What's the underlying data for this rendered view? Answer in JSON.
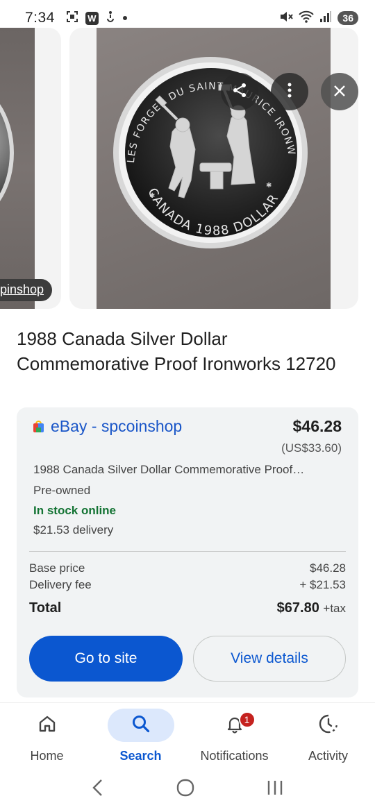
{
  "status_bar": {
    "time": "7:34",
    "left_icons": [
      "screenshot-icon",
      "w-app-icon",
      "accessibility-icon",
      "dot-icon"
    ],
    "right_icons": [
      "mute-icon",
      "wifi-icon",
      "signal-icon"
    ],
    "battery": "36",
    "w_label": "W"
  },
  "carousel": {
    "source_chip_left": "pinshop",
    "coin_inscription_top": "LES FORGES DU SAINT-MAURICE IRONWORKS",
    "coin_inscription_bottom": "CANADA 1988 DOLLAR",
    "actions": [
      "share-icon",
      "more-vert-icon",
      "close-icon"
    ]
  },
  "product": {
    "title": "1988 Canada Silver Dollar Commemorative Proof Ironworks 12720"
  },
  "offer": {
    "merchant": "eBay - spcoinshop",
    "price": "$46.28",
    "price_usd": "(US$33.60)",
    "description": "1988 Canada Silver Dollar Commemorative Proof…",
    "condition": "Pre-owned",
    "stock_status": "In stock online",
    "delivery": "$21.53 delivery",
    "breakdown": {
      "base_label": "Base price",
      "base_value": "$46.28",
      "fee_label": "Delivery fee",
      "fee_value": "+ $21.53",
      "total_label": "Total",
      "total_value": "$67.80",
      "tax_label": "+tax"
    },
    "go_button": "Go to site",
    "details_button": "View details"
  },
  "bottom_nav": {
    "items": [
      {
        "label": "Home",
        "icon": "home-icon"
      },
      {
        "label": "Search",
        "icon": "search-icon",
        "active": true
      },
      {
        "label": "Notifications",
        "icon": "bell-icon",
        "badge": "1"
      },
      {
        "label": "Activity",
        "icon": "activity-icon"
      }
    ]
  },
  "colors": {
    "accent": "#0b57d0",
    "stock_green": "#137333",
    "badge_red": "#c5221f"
  }
}
